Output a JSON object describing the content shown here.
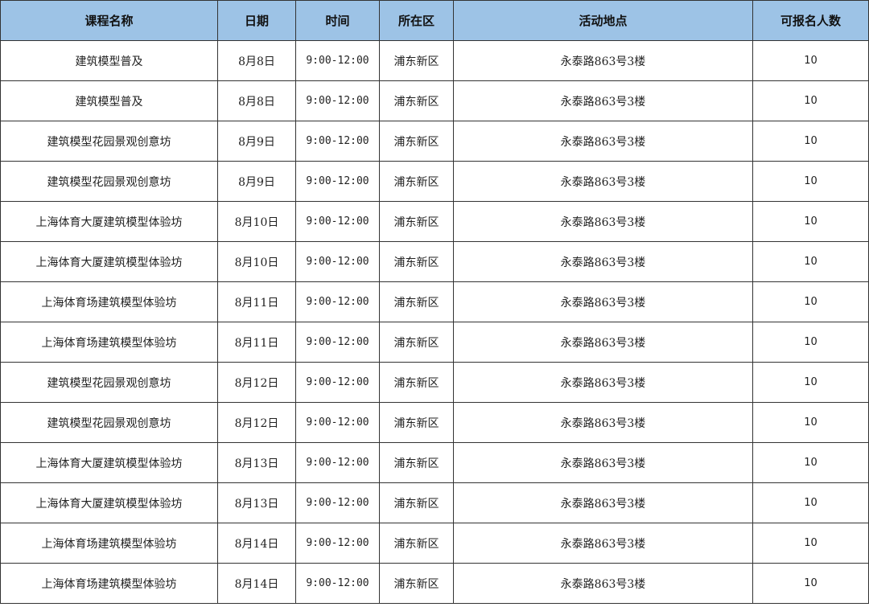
{
  "table": {
    "headers": [
      "课程名称",
      "日期",
      "时间",
      "所在区",
      "活动地点",
      "可报名人数"
    ],
    "rows": [
      [
        "建筑模型普及",
        "8月8日",
        "9:00-12:00",
        "浦东新区",
        "永泰路863号3楼",
        "10"
      ],
      [
        "建筑模型普及",
        "8月8日",
        "9:00-12:00",
        "浦东新区",
        "永泰路863号3楼",
        "10"
      ],
      [
        "建筑模型花园景观创意坊",
        "8月9日",
        "9:00-12:00",
        "浦东新区",
        "永泰路863号3楼",
        "10"
      ],
      [
        "建筑模型花园景观创意坊",
        "8月9日",
        "9:00-12:00",
        "浦东新区",
        "永泰路863号3楼",
        "10"
      ],
      [
        "上海体育大厦建筑模型体验坊",
        "8月10日",
        "9:00-12:00",
        "浦东新区",
        "永泰路863号3楼",
        "10"
      ],
      [
        "上海体育大厦建筑模型体验坊",
        "8月10日",
        "9:00-12:00",
        "浦东新区",
        "永泰路863号3楼",
        "10"
      ],
      [
        "上海体育场建筑模型体验坊",
        "8月11日",
        "9:00-12:00",
        "浦东新区",
        "永泰路863号3楼",
        "10"
      ],
      [
        "上海体育场建筑模型体验坊",
        "8月11日",
        "9:00-12:00",
        "浦东新区",
        "永泰路863号3楼",
        "10"
      ],
      [
        "建筑模型花园景观创意坊",
        "8月12日",
        "9:00-12:00",
        "浦东新区",
        "永泰路863号3楼",
        "10"
      ],
      [
        "建筑模型花园景观创意坊",
        "8月12日",
        "9:00-12:00",
        "浦东新区",
        "永泰路863号3楼",
        "10"
      ],
      [
        "上海体育大厦建筑模型体验坊",
        "8月13日",
        "9:00-12:00",
        "浦东新区",
        "永泰路863号3楼",
        "10"
      ],
      [
        "上海体育大厦建筑模型体验坊",
        "8月13日",
        "9:00-12:00",
        "浦东新区",
        "永泰路863号3楼",
        "10"
      ],
      [
        "上海体育场建筑模型体验坊",
        "8月14日",
        "9:00-12:00",
        "浦东新区",
        "永泰路863号3楼",
        "10"
      ],
      [
        "上海体育场建筑模型体验坊",
        "8月14日",
        "9:00-12:00",
        "浦东新区",
        "永泰路863号3楼",
        "10"
      ]
    ]
  },
  "colors": {
    "header_bg": "#9dc3e6",
    "border": "#333333"
  }
}
